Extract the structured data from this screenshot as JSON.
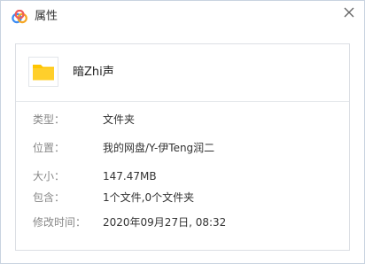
{
  "window": {
    "title": "属性",
    "icons": {
      "app": "baidu-netdisk-cloud-icon",
      "close": "close-icon"
    }
  },
  "file": {
    "icon": "folder-icon",
    "name": "暗Zhi声"
  },
  "properties": [
    {
      "label": "类型：",
      "value": "文件夹"
    },
    {
      "label": "位置：",
      "value": "我的网盘/Y-伊Teng润二"
    },
    {
      "label": "大小：",
      "value": "147.47MB"
    },
    {
      "label": "包含：",
      "value": "1个文件,0个文件夹"
    },
    {
      "label": "修改时间：",
      "value": "2020年09月27日, 08:32"
    }
  ],
  "colors": {
    "folder": "#ffc500",
    "icon_blue": "#3b8cf4",
    "icon_red": "#f05a5a",
    "icon_orange": "#f6a623"
  }
}
